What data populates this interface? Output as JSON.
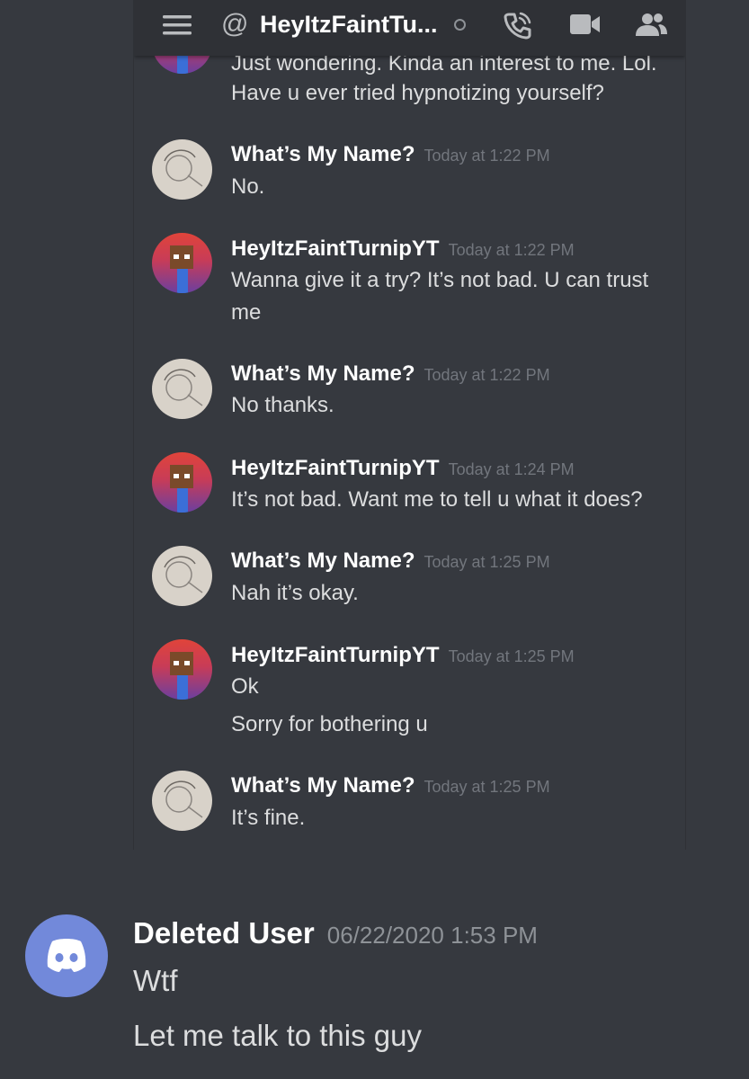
{
  "dm": {
    "header": {
      "at_symbol": "@",
      "title": "HeyItzFaintTu...",
      "icons": [
        "menu-icon",
        "phone-call-icon",
        "video-icon",
        "members-icon"
      ]
    },
    "partial_message": {
      "lines": [
        "Just wondering. Kinda an interest to me. Lol.",
        "Have u ever tried hypnotizing yourself?"
      ]
    },
    "messages": [
      {
        "author": "What’s My Name?",
        "time": "Today at 1:22 PM",
        "lines": [
          "No."
        ]
      },
      {
        "author": "HeyItzFaintTurnipYT",
        "time": "Today at 1:22 PM",
        "lines": [
          "Wanna give it a try? It’s not bad. U can trust me"
        ]
      },
      {
        "author": "What’s My Name?",
        "time": "Today at 1:22 PM",
        "lines": [
          "No thanks."
        ]
      },
      {
        "author": "HeyItzFaintTurnipYT",
        "time": "Today at 1:24 PM",
        "lines": [
          "It’s not bad. Want me to tell u what it does?"
        ]
      },
      {
        "author": "What’s My Name?",
        "time": "Today at 1:25 PM",
        "lines": [
          "Nah it’s okay."
        ]
      },
      {
        "author": "HeyItzFaintTurnipYT",
        "time": "Today at 1:25 PM",
        "lines": [
          "Ok",
          "Sorry for bothering u"
        ]
      },
      {
        "author": "What’s My Name?",
        "time": "Today at 1:25 PM",
        "lines": [
          "It’s fine."
        ]
      }
    ]
  },
  "outer_message": {
    "author": "Deleted User",
    "time": "06/22/2020 1:53 PM",
    "lines": [
      "Wtf",
      "Let me talk to this guy"
    ],
    "avatar_color": "#7289da"
  },
  "colors": {
    "background": "#36393f",
    "header": "#2f3136",
    "username": "#ffffff",
    "timestamp": "#72767d",
    "text": "#dcddde"
  }
}
